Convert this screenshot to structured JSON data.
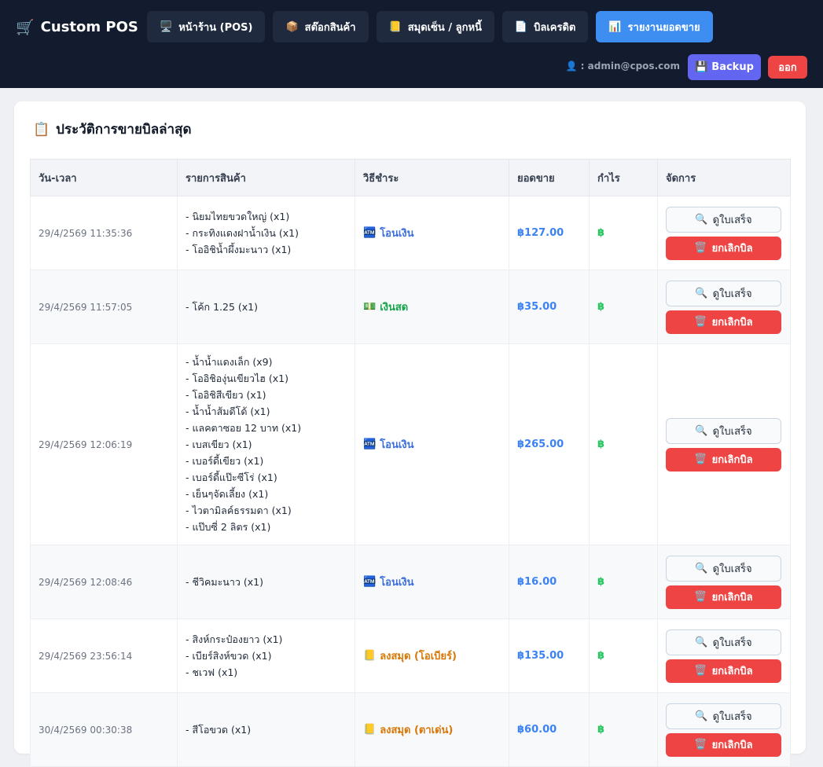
{
  "app": {
    "brand": "Custom POS",
    "brand_icon": "cart-icon"
  },
  "nav": [
    {
      "icon": "🖥️",
      "label": "หน้าร้าน (POS)",
      "active": false
    },
    {
      "icon": "📦",
      "label": "สต๊อกสินค้า",
      "active": false
    },
    {
      "icon": "📒",
      "label": "สมุดเซ็น / ลูกหนี้",
      "active": false
    },
    {
      "icon": "📄",
      "label": "บิลเครดิต",
      "active": false
    },
    {
      "icon": "📊",
      "label": "รายงานยอดขาย",
      "active": true
    }
  ],
  "user": {
    "icon": "👤",
    "label": ": admin@cpos.com"
  },
  "actions": {
    "backup_icon": "💾",
    "backup": "Backup",
    "logout": "ออก"
  },
  "page": {
    "title_icon": "📋",
    "title": "ประวัติการขายบิลล่าสุด"
  },
  "table": {
    "headers": [
      "วัน-เวลา",
      "รายการสินค้า",
      "วิธีชำระ",
      "ยอดขาย",
      "กำไร",
      "จัดการ"
    ],
    "view_label": "ดูใบเสร็จ",
    "cancel_label": "ยกเลิกบิล",
    "view_icon": "🔍",
    "cancel_icon": "🗑️",
    "rows": [
      {
        "datetime": "29/4/2569 11:35:36",
        "items": [
          "- นิยมไทยขวดใหญ่ (x1)",
          "- กระทิงแดงฝาน้ำเงิน (x1)",
          "- โออิชิน้ำผึ้งมะนาว (x1)"
        ],
        "pay_icon": "🏧",
        "payment": "โอนเงิน",
        "pay_color": "blue",
        "total": "฿127.00",
        "profit": "฿"
      },
      {
        "datetime": "29/4/2569 11:57:05",
        "items": [
          "- โค้ก 1.25 (x1)"
        ],
        "pay_icon": "💵",
        "payment": "เงินสด",
        "pay_color": "green",
        "total": "฿35.00",
        "profit": "฿"
      },
      {
        "datetime": "29/4/2569 12:06:19",
        "items": [
          "- น้ำน้ำแดงเล็ก (x9)",
          "- โออิชิองุ่นเขียวไฮ (x1)",
          "- โออิชิสีเขียว (x1)",
          "- น้ำน้ำส้มดีโด้ (x1)",
          "- แลคตาซอย 12 บาท (x1)",
          "- เบสเขียว (x1)",
          "- เบอร์ดี้เขียว (x1)",
          "- เบอร์ดี้แป๊ะซีโร่ (x1)",
          "- เย็นๆจัดเลี้ยง (x1)",
          "- ไวตามิลค์ธรรมดา (x1)",
          "- แป๊บซี่ 2 ลิตร (x1)"
        ],
        "pay_icon": "🏧",
        "payment": "โอนเงิน",
        "pay_color": "blue",
        "total": "฿265.00",
        "profit": "฿"
      },
      {
        "datetime": "29/4/2569 12:08:46",
        "items": [
          "- ชีวิคมะนาว (x1)"
        ],
        "pay_icon": "🏧",
        "payment": "โอนเงิน",
        "pay_color": "blue",
        "total": "฿16.00",
        "profit": "฿"
      },
      {
        "datetime": "29/4/2569 23:56:14",
        "items": [
          "- สิงห์กระป๋องยาว (x1)",
          "- เบียร์สิงห์ขวด (x1)",
          "- ชเวฟ (x1)"
        ],
        "pay_icon": "📒",
        "payment": "ลงสมุด (โอเบียร์)",
        "pay_color": "orange",
        "total": "฿135.00",
        "profit": "฿"
      },
      {
        "datetime": "30/4/2569 00:30:38",
        "items": [
          "- สีโอขวด (x1)"
        ],
        "pay_icon": "📒",
        "payment": "ลงสมุด (ตาเด่น)",
        "pay_color": "orange",
        "total": "฿60.00",
        "profit": "฿"
      }
    ]
  }
}
